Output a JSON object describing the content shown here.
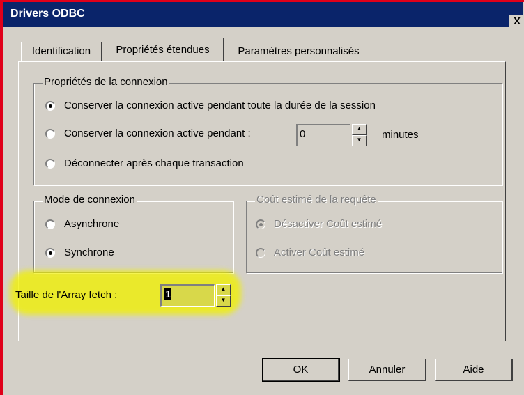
{
  "window": {
    "title": "Drivers ODBC",
    "close_label": "X"
  },
  "tabs": [
    {
      "label": "Identification",
      "active": false
    },
    {
      "label": "Propriétés étendues",
      "active": true
    },
    {
      "label": "Paramètres personnalisés",
      "active": false
    }
  ],
  "connection_props": {
    "label": "Propriétés de la connexion",
    "option_keep_session": "Conserver la connexion active pendant toute la durée de la session",
    "option_keep_for": "Conserver la connexion active pendant :",
    "minutes_value": "0",
    "minutes_unit": "minutes",
    "option_disconnect": "Déconnecter après chaque transaction",
    "selected": "keep_session"
  },
  "connection_mode": {
    "label": "Mode de connexion",
    "async_label": "Asynchrone",
    "sync_label": "Synchrone",
    "selected": "sync"
  },
  "query_cost": {
    "label": "Coût estimé de la requête",
    "disable_label": "Désactiver Coût estimé",
    "enable_label": "Activer Coût estimé",
    "selected": "disable",
    "enabled": false
  },
  "array_fetch": {
    "label": "Taille de l'Array fetch :",
    "value": "1"
  },
  "buttons": {
    "ok": "OK",
    "cancel": "Annuler",
    "help": "Aide"
  },
  "colors": {
    "titlebar": "#0a246a",
    "dialog": "#d4d0c8",
    "highlight": "#f1f100",
    "red_border": "#e0001a"
  },
  "icons": {
    "spin_up": "▲",
    "spin_down": "▼"
  }
}
